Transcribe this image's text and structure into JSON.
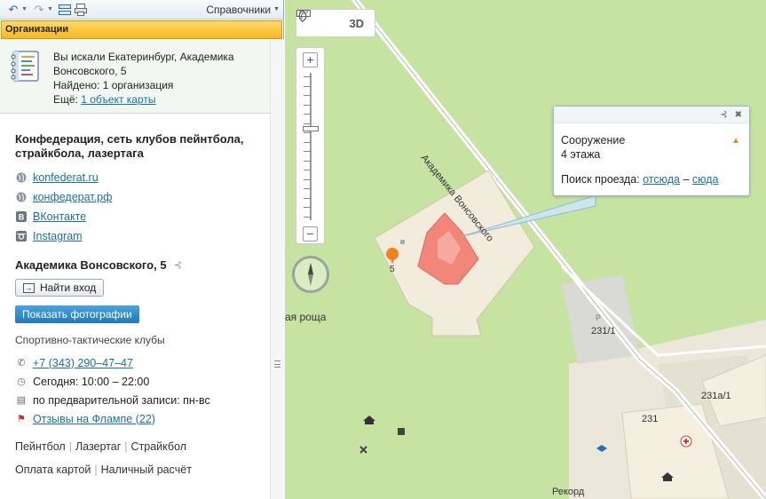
{
  "toolbar": {
    "directory_label": "Справочники"
  },
  "panel": {
    "header_title": "Организации"
  },
  "search": {
    "query_text": "Вы искали Екатеринбург, Академика Вонсовского, 5",
    "found_text": "Найдено: 1 организация",
    "also_label": "Ещё:",
    "also_link": "1 объект карты"
  },
  "org": {
    "name": "Конфедерация, сеть клубов пейнтбола, страйкбола, лазертага",
    "links": [
      {
        "label": "konfederat.ru",
        "icon": "globe-icon"
      },
      {
        "label": "конфедерат.рф",
        "icon": "globe-icon"
      },
      {
        "label": "ВКонтакте",
        "icon": "vk-icon"
      },
      {
        "label": "Instagram",
        "icon": "instagram-icon"
      }
    ],
    "address": "Академика Вонсовского, 5",
    "route_button": "Найти вход",
    "photo_button": "Показать фотографии",
    "category": "Спортивно-тактические клубы",
    "phone": "+7 (343) 290–47–47",
    "hours": "Сегодня: 10:00 – 22:00",
    "schedule": "по предварительной записи: пн-вс",
    "reviews": "Отзывы на Флампе (22)",
    "tags1": [
      "Пейнтбол",
      "Лазертаг",
      "Страйкбол"
    ],
    "tags2": [
      "Оплата картой",
      "Наличный расчёт"
    ]
  },
  "map": {
    "tool_3d": "3D",
    "street_label": "Академика Вонсовского",
    "grove_label": "ая роща",
    "building_number": "5",
    "labels": [
      "231/1",
      "231а/1",
      "231",
      "Рекорд"
    ],
    "parking_letter": "P",
    "colors": {
      "building": "#f2867a",
      "grass": "#c6e3a2",
      "plot": "#f1ecdc",
      "marker": "#f58220"
    }
  },
  "popup": {
    "title": "Сооружение",
    "floors": "4 этажа",
    "route_label": "Поиск проезда:",
    "route_from": "отсюда",
    "route_dash": "–",
    "route_to": "сюда"
  }
}
